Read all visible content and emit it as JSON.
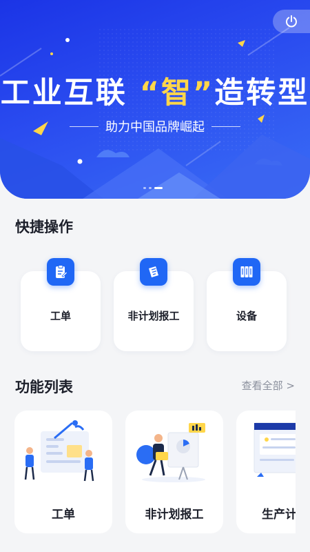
{
  "banner": {
    "title_part1": "工业互联 ",
    "title_quote": "“智”",
    "title_part2": "造转型",
    "subtitle": "助力中国品牌崛起",
    "power_icon": "power-icon",
    "colors": {
      "gradient_start": "#1b34e6",
      "gradient_end": "#3a6df5",
      "accent": "#ffd64a"
    }
  },
  "quick_actions": {
    "title": "快捷操作",
    "items": [
      {
        "label": "工单",
        "icon": "clipboard-icon"
      },
      {
        "label": "非计划报工",
        "icon": "report-icon"
      },
      {
        "label": "设备",
        "icon": "equipment-icon"
      }
    ],
    "accent": "#2067f5"
  },
  "functions": {
    "title": "功能列表",
    "view_all": "查看全部 >",
    "items": [
      {
        "label": "工单"
      },
      {
        "label": "非计划报工"
      },
      {
        "label": "生产计划"
      }
    ]
  }
}
